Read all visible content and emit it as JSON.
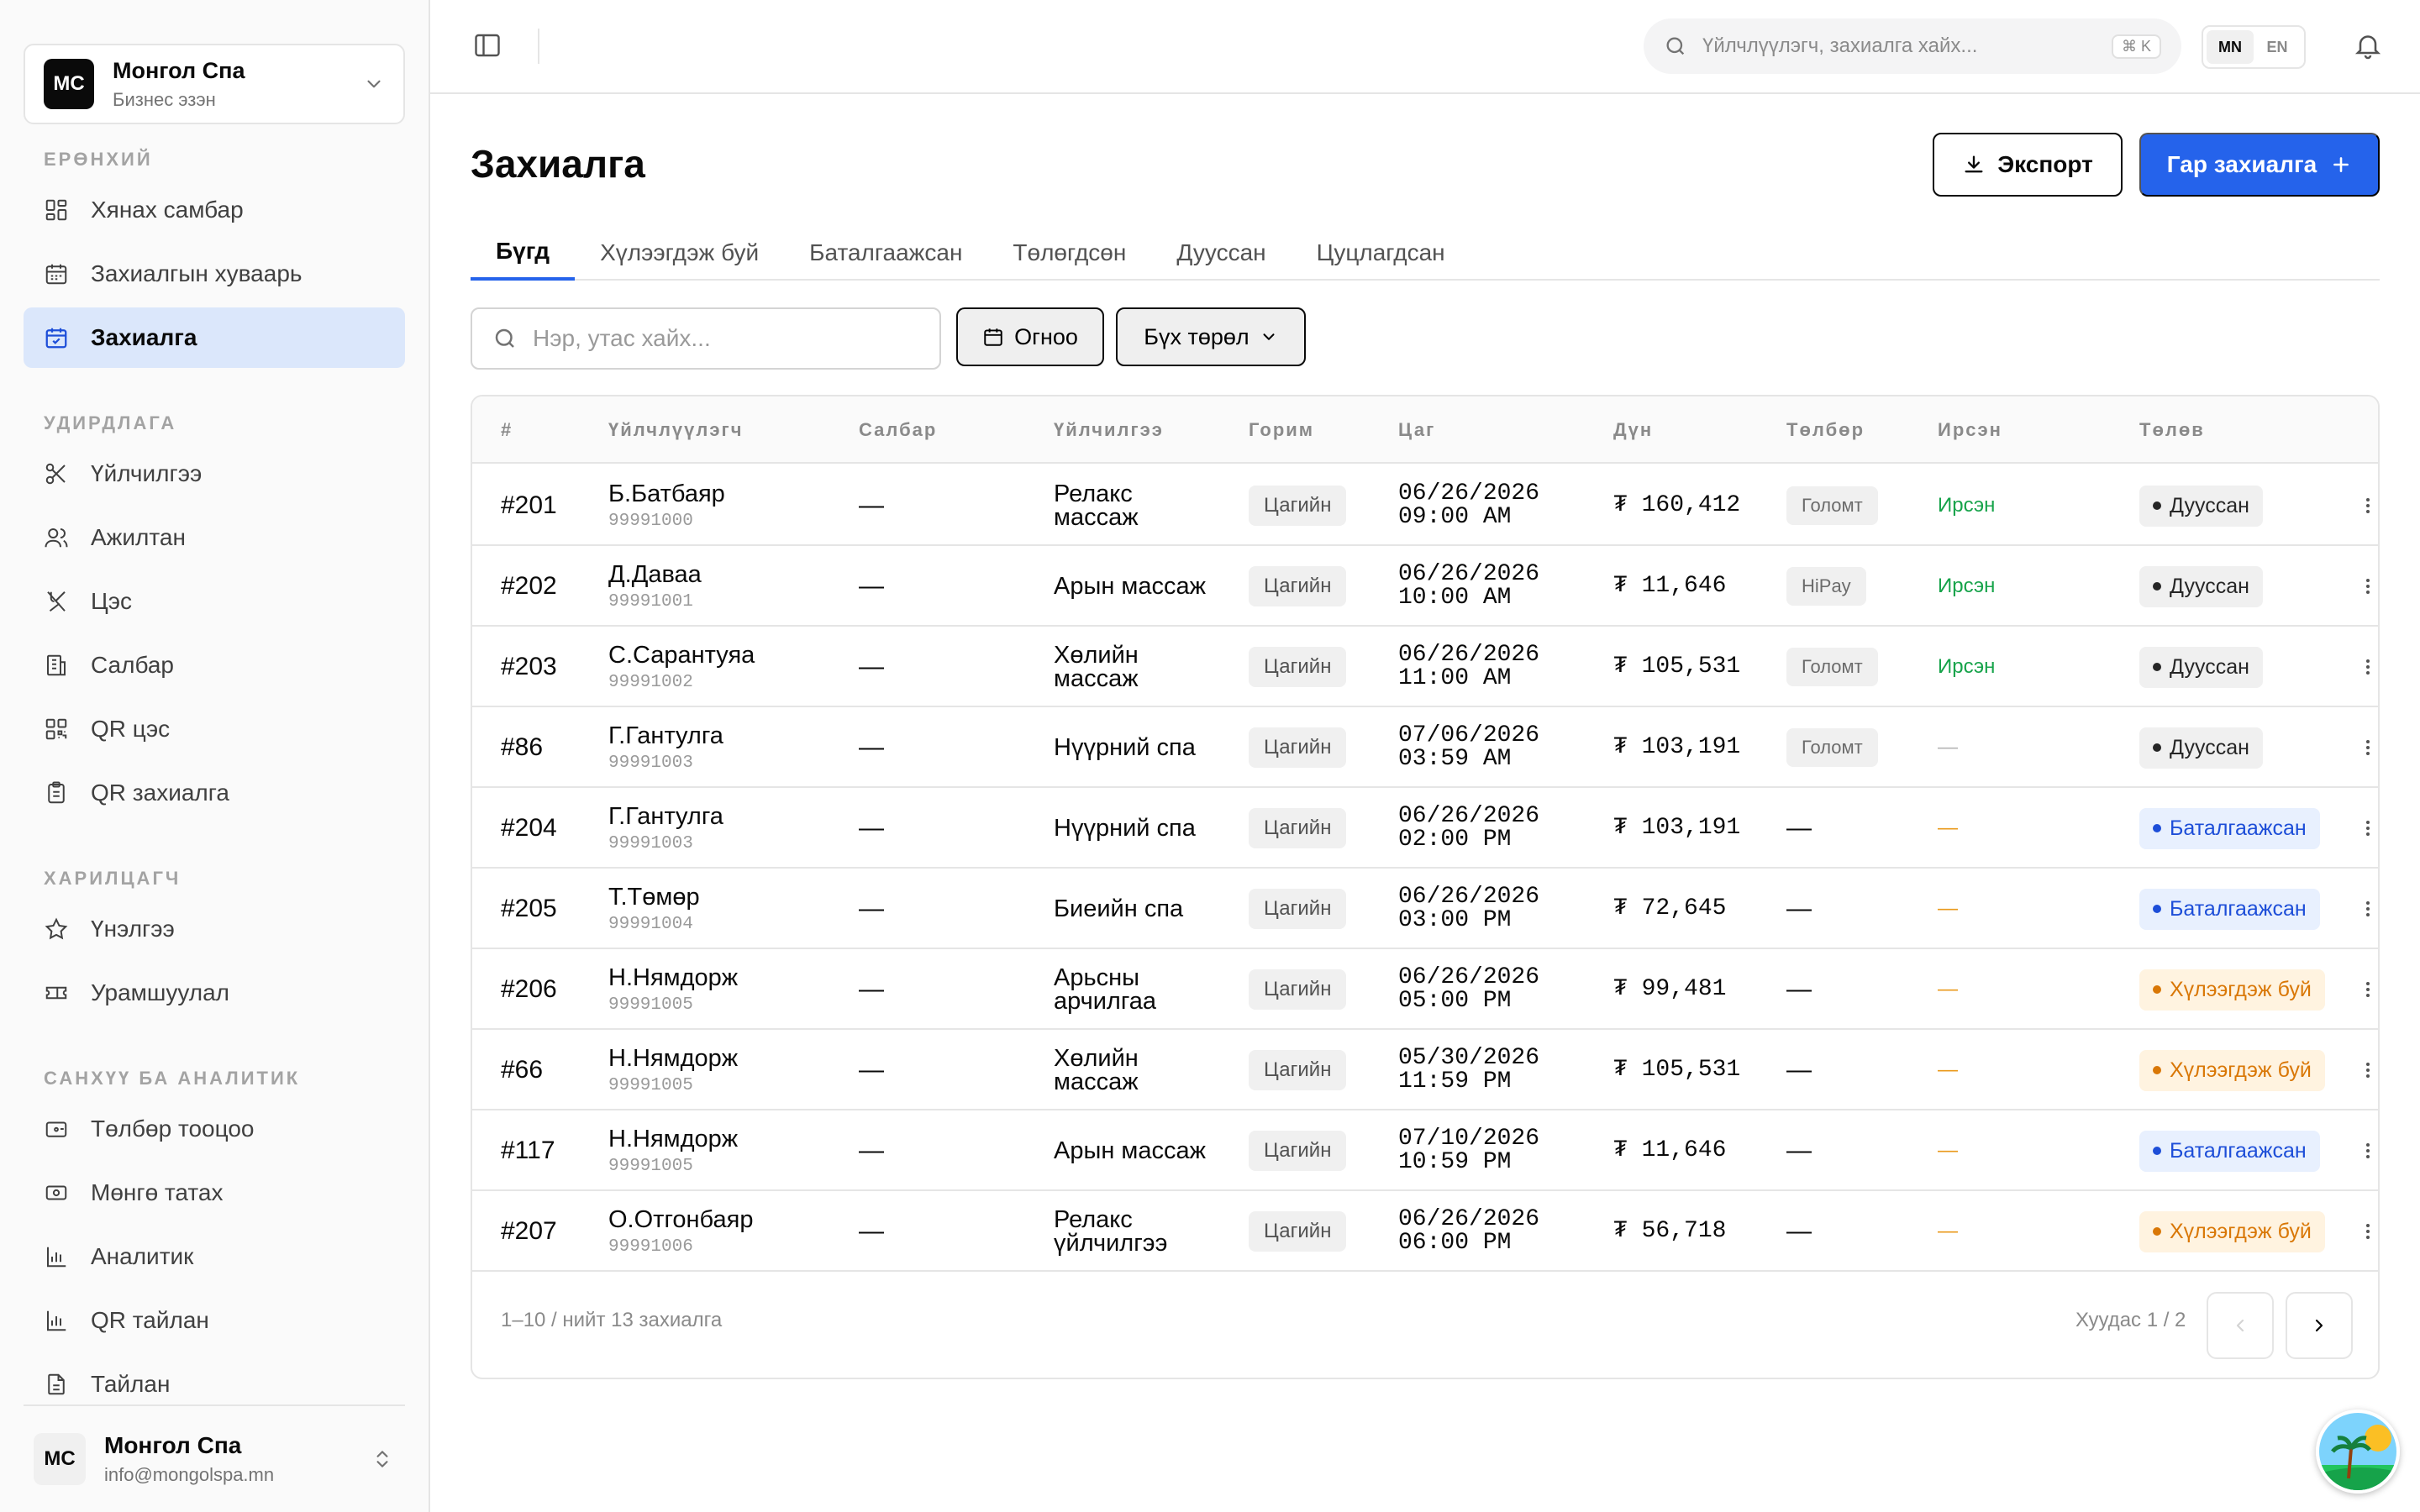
{
  "org": {
    "initials": "МС",
    "name": "Монгол Спа",
    "role": "Бизнес эзэн"
  },
  "nav": {
    "general": {
      "title": "Ерөнхий",
      "items": [
        {
          "label": "Хянах самбар",
          "icon": "dashboard-icon"
        },
        {
          "label": "Захиалгын хуваарь",
          "icon": "calendar-icon"
        },
        {
          "label": "Захиалга",
          "icon": "calendar-check-icon",
          "active": true
        }
      ]
    },
    "management": {
      "title": "Удирдлага",
      "items": [
        {
          "label": "Үйлчилгээ",
          "icon": "scissors-icon"
        },
        {
          "label": "Ажилтан",
          "icon": "users-icon"
        },
        {
          "label": "Цэс",
          "icon": "utensils-icon"
        },
        {
          "label": "Салбар",
          "icon": "building-icon"
        },
        {
          "label": "QR цэс",
          "icon": "qr-code-icon"
        },
        {
          "label": "QR захиалга",
          "icon": "clipboard-icon"
        }
      ]
    },
    "customers": {
      "title": "Харилцагч",
      "items": [
        {
          "label": "Үнэлгээ",
          "icon": "star-icon"
        },
        {
          "label": "Урамшуулал",
          "icon": "ticket-icon"
        }
      ]
    },
    "finance": {
      "title": "Санхүү ба аналитик",
      "items": [
        {
          "label": "Төлбөр тооцоо",
          "icon": "wallet-icon"
        },
        {
          "label": "Мөнгө татах",
          "icon": "banknote-icon"
        },
        {
          "label": "Аналитик",
          "icon": "bar-chart-icon"
        },
        {
          "label": "QR тайлан",
          "icon": "bar-chart-icon"
        },
        {
          "label": "Тайлан",
          "icon": "file-icon"
        }
      ]
    }
  },
  "user": {
    "initials": "МС",
    "name": "Монгол Спа",
    "email": "info@mongolspa.mn"
  },
  "topbar": {
    "search_placeholder": "Үйлчлүүлэгч, захиалга хайх...",
    "shortcut": "⌘ K",
    "lang_mn": "MN",
    "lang_en": "EN"
  },
  "page": {
    "title": "Захиалга",
    "export_label": "Экспорт",
    "manual_label": "Гар захиалга"
  },
  "tabs": [
    "Бүгд",
    "Хүлээгдэж буй",
    "Баталгаажсан",
    "Төлөгдсөн",
    "Дууссан",
    "Цуцлагдсан"
  ],
  "filters": {
    "search_placeholder": "Нэр, утас хайх...",
    "date_label": "Огноо",
    "type_label": "Бүх төрөл"
  },
  "table": {
    "columns": [
      "#",
      "Үйлчлүүлэгч",
      "Салбар",
      "Үйлчилгээ",
      "Горим",
      "Цаг",
      "Дүн",
      "Төлбөр",
      "Ирсэн",
      "Төлөв"
    ],
    "rows": [
      {
        "id": "#201",
        "name": "Б.Батбаяр",
        "phone": "99991000",
        "branch": "—",
        "service": "Релакс массаж",
        "mode": "Цагийн",
        "date": "06/26/2026",
        "time": "09:00 AM",
        "amount": "₮ 160,412",
        "payment": "Голомт",
        "arrived": "Ирсэн",
        "arrived_state": "yes",
        "status": "Дууссан",
        "status_type": "done"
      },
      {
        "id": "#202",
        "name": "Д.Даваа",
        "phone": "99991001",
        "branch": "—",
        "service": "Арын массаж",
        "mode": "Цагийн",
        "date": "06/26/2026",
        "time": "10:00 AM",
        "amount": "₮ 11,646",
        "payment": "HiPay",
        "arrived": "Ирсэн",
        "arrived_state": "yes",
        "status": "Дууссан",
        "status_type": "done"
      },
      {
        "id": "#203",
        "name": "С.Сарантуяа",
        "phone": "99991002",
        "branch": "—",
        "service": "Хөлийн массаж",
        "mode": "Цагийн",
        "date": "06/26/2026",
        "time": "11:00 AM",
        "amount": "₮ 105,531",
        "payment": "Голомт",
        "arrived": "Ирсэн",
        "arrived_state": "yes",
        "status": "Дууссан",
        "status_type": "done"
      },
      {
        "id": "#86",
        "name": "Г.Гантулга",
        "phone": "99991003",
        "branch": "—",
        "service": "Нүүрний спа",
        "mode": "Цагийн",
        "date": "07/06/2026",
        "time": "03:59 AM",
        "amount": "₮ 103,191",
        "payment": "Голомт",
        "arrived": "—",
        "arrived_state": "none",
        "status": "Дууссан",
        "status_type": "done"
      },
      {
        "id": "#204",
        "name": "Г.Гантулга",
        "phone": "99991003",
        "branch": "—",
        "service": "Нүүрний спа",
        "mode": "Цагийн",
        "date": "06/26/2026",
        "time": "02:00 PM",
        "amount": "₮ 103,191",
        "payment": "—",
        "arrived": "—",
        "arrived_state": "pending",
        "status": "Баталгаажсан",
        "status_type": "confirmed"
      },
      {
        "id": "#205",
        "name": "Т.Төмөр",
        "phone": "99991004",
        "branch": "—",
        "service": "Биеийн спа",
        "mode": "Цагийн",
        "date": "06/26/2026",
        "time": "03:00 PM",
        "amount": "₮ 72,645",
        "payment": "—",
        "arrived": "—",
        "arrived_state": "pending",
        "status": "Баталгаажсан",
        "status_type": "confirmed"
      },
      {
        "id": "#206",
        "name": "Н.Нямдорж",
        "phone": "99991005",
        "branch": "—",
        "service": "Арьсны арчилгаа",
        "mode": "Цагийн",
        "date": "06/26/2026",
        "time": "05:00 PM",
        "amount": "₮ 99,481",
        "payment": "—",
        "arrived": "—",
        "arrived_state": "pending",
        "status": "Хүлээгдэж буй",
        "status_type": "pending"
      },
      {
        "id": "#66",
        "name": "Н.Нямдорж",
        "phone": "99991005",
        "branch": "—",
        "service": "Хөлийн массаж",
        "mode": "Цагийн",
        "date": "05/30/2026",
        "time": "11:59 PM",
        "amount": "₮ 105,531",
        "payment": "—",
        "arrived": "—",
        "arrived_state": "pending",
        "status": "Хүлээгдэж буй",
        "status_type": "pending"
      },
      {
        "id": "#117",
        "name": "Н.Нямдорж",
        "phone": "99991005",
        "branch": "—",
        "service": "Арын массаж",
        "mode": "Цагийн",
        "date": "07/10/2026",
        "time": "10:59 PM",
        "amount": "₮ 11,646",
        "payment": "—",
        "arrived": "—",
        "arrived_state": "pending",
        "status": "Баталгаажсан",
        "status_type": "confirmed"
      },
      {
        "id": "#207",
        "name": "О.Отгонбаяр",
        "phone": "99991006",
        "branch": "—",
        "service": "Релакс үйлчилгээ",
        "mode": "Цагийн",
        "date": "06/26/2026",
        "time": "06:00 PM",
        "amount": "₮ 56,718",
        "payment": "—",
        "arrived": "—",
        "arrived_state": "pending",
        "status": "Хүлээгдэж буй",
        "status_type": "pending"
      }
    ]
  },
  "pagination": {
    "summary": "1–10 / нийт 13 захиалга",
    "page_info": "Хуудас 1 / 2"
  },
  "colors": {
    "accent": "#2563eb",
    "active_nav_bg": "#dbe7fb",
    "arrived_green": "#16a34a",
    "pending_orange": "#d97706"
  }
}
